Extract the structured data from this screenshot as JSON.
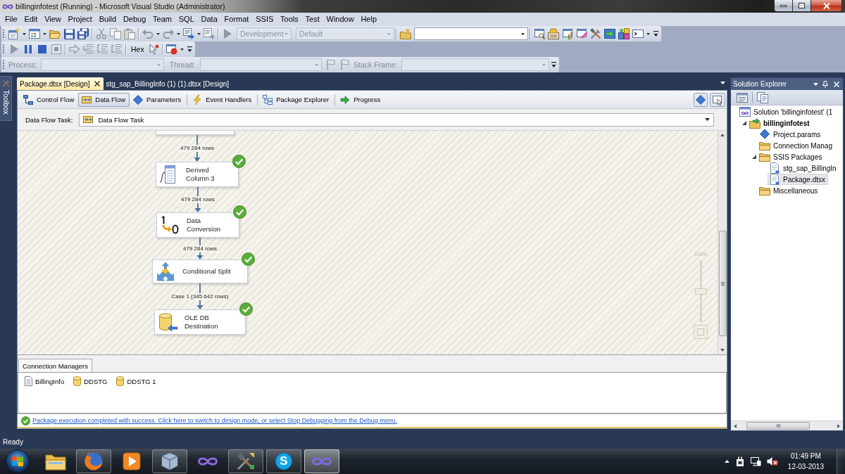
{
  "window": {
    "title": "billinginfotest (Running) - Microsoft Visual Studio (Administrator)"
  },
  "menu": [
    "File",
    "Edit",
    "View",
    "Project",
    "Build",
    "Debug",
    "Team",
    "SQL",
    "Data",
    "Format",
    "SSIS",
    "Tools",
    "Test",
    "Window",
    "Help"
  ],
  "standard_toolbar": {
    "configuration": {
      "value": "Development",
      "disabled": true
    },
    "platform": {
      "value": "Default",
      "disabled": true
    }
  },
  "debug_toolbar": {
    "hex_button": "Hex"
  },
  "debug_location_toolbar": {
    "process_label": "Process:",
    "thread_label": "Thread:",
    "stack_frame_label": "Stack Frame:",
    "disabled": true
  },
  "toolbox_tab": "Toolbox",
  "document_tabs": [
    {
      "label": "Package.dtsx [Design]",
      "selected": true
    },
    {
      "label": "stg_sap_BillingInfo (1) (1).dtsx [Design]",
      "selected": false
    }
  ],
  "designer_tabs": [
    {
      "kind": "control_flow",
      "label": "Control Flow",
      "selected": false
    },
    {
      "kind": "data_flow",
      "label": "Data Flow",
      "selected": true
    },
    {
      "kind": "parameters",
      "label": "Parameters",
      "selected": false
    },
    {
      "kind": "event_handlers",
      "label": "Event Handlers",
      "selected": false
    },
    {
      "kind": "package_explorer",
      "label": "Package Explorer",
      "selected": false
    },
    {
      "kind": "progress",
      "label": "Progress",
      "selected": false
    }
  ],
  "data_flow_task": {
    "label": "Data Flow Task:",
    "value": "Data Flow Task"
  },
  "canvas": {
    "components": [
      {
        "kind": "derived_column",
        "label": "Derived Column 3",
        "input_path": "479 284 rows",
        "succeeded": true
      },
      {
        "kind": "data_conversion",
        "label": "Data Conversion",
        "input_path": "479 284 rows",
        "succeeded": true
      },
      {
        "kind": "conditional_split",
        "label": "Conditional Split",
        "input_path": "479 284 rows",
        "succeeded": true
      },
      {
        "kind": "ole_db_destination",
        "label": "OLE DB Destination",
        "input_path": "Case 1 (345 642 rows)",
        "succeeded": true
      }
    ],
    "zoom": {
      "label": "100%",
      "level": 0.5
    }
  },
  "connection_managers": {
    "title": "Connection Managers",
    "items": [
      {
        "kind": "flat_file",
        "label": "BillingInfo"
      },
      {
        "kind": "ole_db",
        "label": "DDSTG"
      },
      {
        "kind": "ole_db",
        "label": "DDSTG 1"
      }
    ]
  },
  "message_bar": {
    "link": "Package execution completed with success. Click here to switch to design mode, or select Stop Debugging from the Debug menu."
  },
  "solution_explorer": {
    "title": "Solution Explorer",
    "tree": [
      {
        "kind": "solution",
        "label": "Solution 'billinginfotest' (1",
        "selected": false,
        "children": [
          {
            "kind": "project",
            "label": "billinginfotest",
            "selected": false,
            "expanded": true,
            "children": [
              {
                "kind": "params",
                "label": "Project.params",
                "selected": false
              },
              {
                "kind": "folder",
                "label": "Connection Manag",
                "selected": false
              },
              {
                "kind": "folder",
                "label": "SSIS Packages",
                "selected": false,
                "expanded": true,
                "children": [
                  {
                    "kind": "package",
                    "label": "stg_sap_BillingIn",
                    "selected": false
                  },
                  {
                    "kind": "package",
                    "label": "Package.dtsx",
                    "selected": true
                  }
                ]
              },
              {
                "kind": "folder",
                "label": "Miscellaneous",
                "selected": false
              }
            ]
          }
        ]
      }
    ]
  },
  "status_bar": {
    "text": "Ready"
  },
  "taskbar": {
    "apps": [
      {
        "running": false,
        "selected": false
      },
      {
        "running": true,
        "selected": false
      },
      {
        "running": false,
        "selected": false
      },
      {
        "running": true,
        "selected": false
      },
      {
        "running": false,
        "selected": false
      },
      {
        "running": true,
        "selected": false
      },
      {
        "running": true,
        "selected": false,
        "glyph": "S"
      },
      {
        "running": true,
        "selected": true
      }
    ],
    "clock": {
      "time": "01:49 PM",
      "date": "12-03-2013"
    }
  }
}
